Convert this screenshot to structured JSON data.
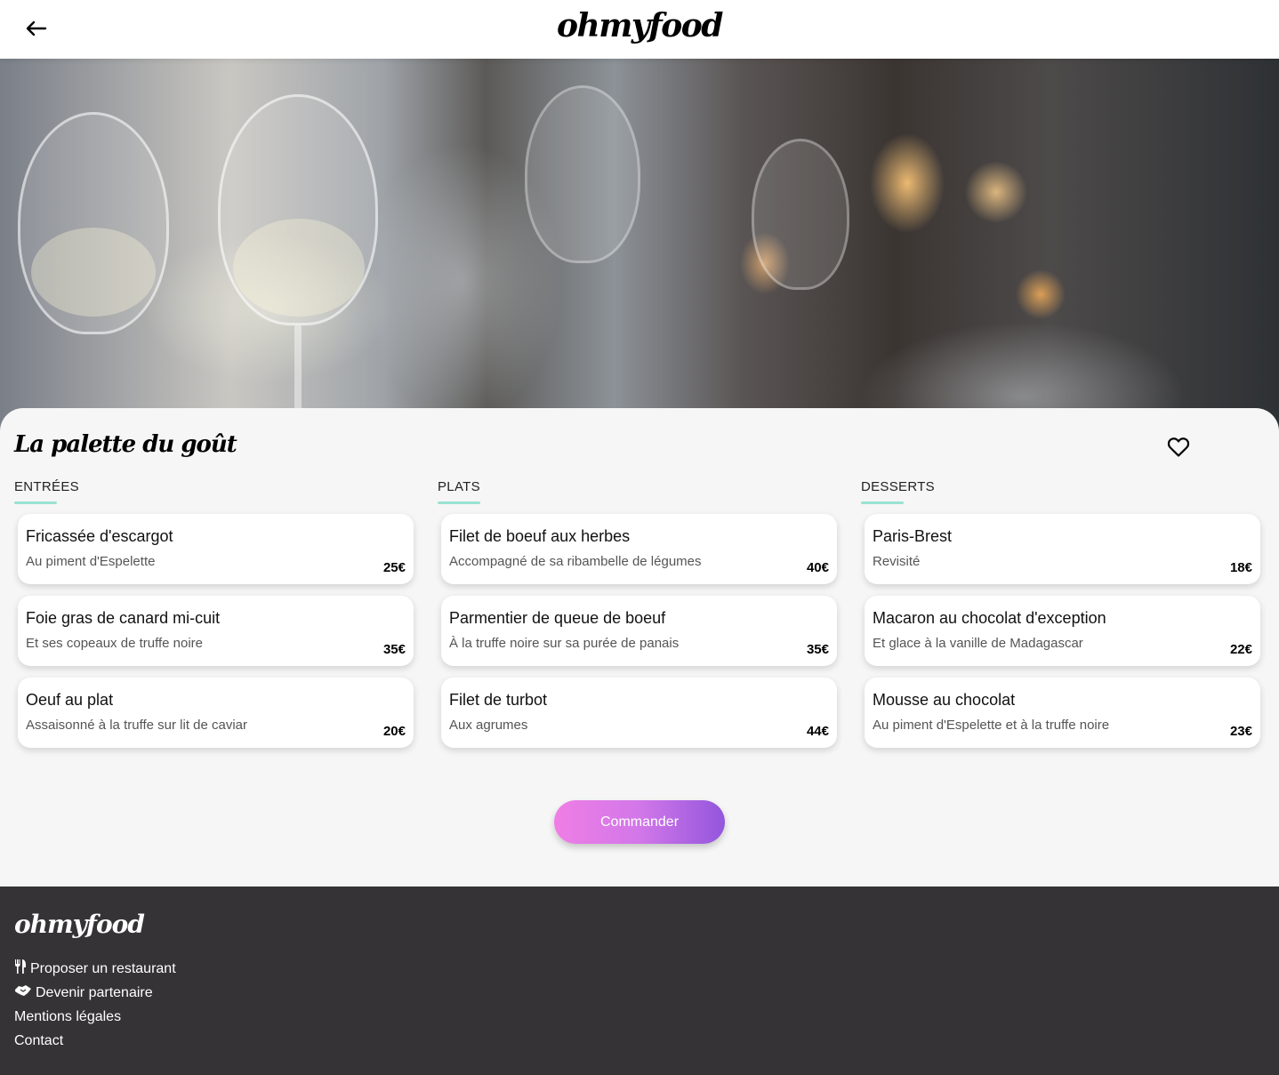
{
  "header": {
    "logo": "ohmyfood",
    "back_icon": "arrow-left-icon"
  },
  "restaurant": {
    "name": "La palette du goût",
    "favorite_icon": "heart-outline-icon"
  },
  "menu": {
    "columns": [
      {
        "title": "ENTRÉES",
        "dishes": [
          {
            "name": "Fricassée d'escargot",
            "description": "Au piment d'Espelette",
            "price": "25€"
          },
          {
            "name": "Foie gras de canard mi-cuit",
            "description": "Et ses copeaux de truffe noire",
            "price": "35€"
          },
          {
            "name": "Oeuf au plat",
            "description": "Assaisonné à la truffe sur lit de caviar",
            "price": "20€"
          }
        ]
      },
      {
        "title": "PLATS",
        "dishes": [
          {
            "name": "Filet de boeuf aux herbes",
            "description": "Accompagné de sa ribambelle de légumes",
            "price": "40€"
          },
          {
            "name": "Parmentier de queue de boeuf",
            "description": "À la truffe noire sur sa purée de panais",
            "price": "35€"
          },
          {
            "name": "Filet de turbot",
            "description": "Aux agrumes",
            "price": "44€"
          }
        ]
      },
      {
        "title": "DESSERTS",
        "dishes": [
          {
            "name": "Paris-Brest",
            "description": "Revisité",
            "price": "18€"
          },
          {
            "name": "Macaron au chocolat d'exception",
            "description": "Et glace à la vanille de Madagascar",
            "price": "22€"
          },
          {
            "name": "Mousse au chocolat",
            "description": "Au piment d'Espelette et à la truffe noire",
            "price": "23€"
          }
        ]
      }
    ],
    "accent_underline": "#99e2d0"
  },
  "order_button": {
    "label": "Commander",
    "gradient": [
      "#ef7ee5",
      "#9356dc"
    ]
  },
  "footer": {
    "logo": "ohmyfood",
    "links": [
      {
        "label": "Proposer un restaurant",
        "icon": "utensils-icon"
      },
      {
        "label": "Devenir partenaire",
        "icon": "handshake-icon"
      },
      {
        "label": "Mentions légales",
        "icon": ""
      },
      {
        "label": "Contact",
        "icon": ""
      }
    ],
    "background": "#353335"
  }
}
